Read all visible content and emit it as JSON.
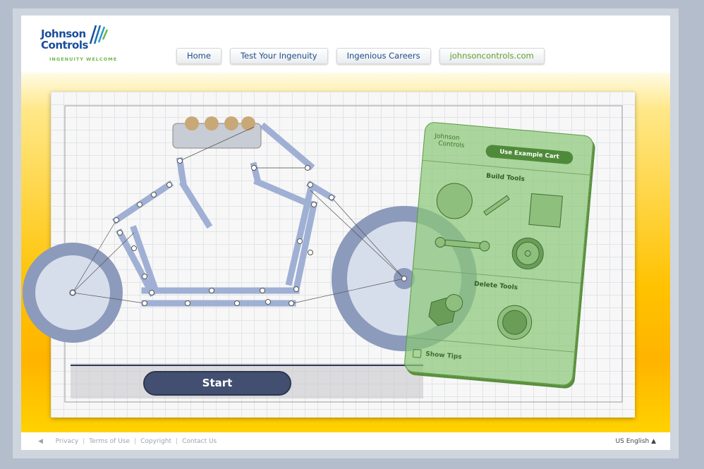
{
  "header": {
    "logo_line1": "Johnson",
    "logo_line2": "Controls",
    "tagline": "INGENUITY WELCOME"
  },
  "nav": [
    "Home",
    "Test Your Ingenuity",
    "Ingenious Careers",
    "johnsoncontrols.com"
  ],
  "tools": {
    "logo_line1": "Johnson",
    "logo_line2": "Controls",
    "use_example": "Use Example Cart",
    "build_title": "Build Tools",
    "delete_title": "Delete Tools",
    "show_tips": "Show Tips",
    "show_tips_checked": false
  },
  "start_label": "Start",
  "footer": {
    "links": [
      "Privacy",
      "Terms of Use",
      "Copyright",
      "Contact Us"
    ],
    "language": "US English ▲"
  }
}
